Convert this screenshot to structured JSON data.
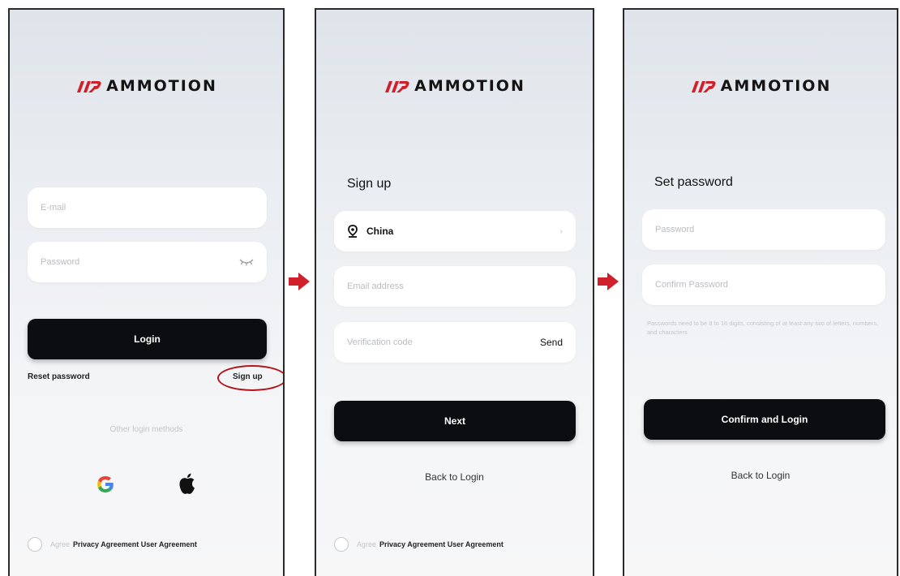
{
  "brand": {
    "name": "AMMOTION"
  },
  "screen_login": {
    "email_placeholder": "E-mail",
    "password_placeholder": "Password",
    "login_label": "Login",
    "reset_password": "Reset password",
    "sign_up": "Sign up",
    "other_methods": "Other login methods",
    "agree_prefix": "Agree",
    "agreements": "Privacy Agreement User Agreement"
  },
  "screen_signup": {
    "title": "Sign up",
    "country": "China",
    "email_placeholder": "Email address",
    "code_placeholder": "Verification code",
    "send_label": "Send",
    "next_label": "Next",
    "back_label": "Back to Login",
    "agree_prefix": "Agree",
    "agreements": "Privacy Agreement User Agreement"
  },
  "screen_setpwd": {
    "title": "Set password",
    "password_placeholder": "Password",
    "confirm_placeholder": "Confirm Password",
    "hint": "Passwords need to be 8 to 16 digits, consisting of at least any two of letters, numbers, and characters",
    "confirm_label": "Confirm and Login",
    "back_label": "Back to Login"
  },
  "colors": {
    "accent_red": "#d0202a",
    "button_dark": "#0c0d10"
  }
}
